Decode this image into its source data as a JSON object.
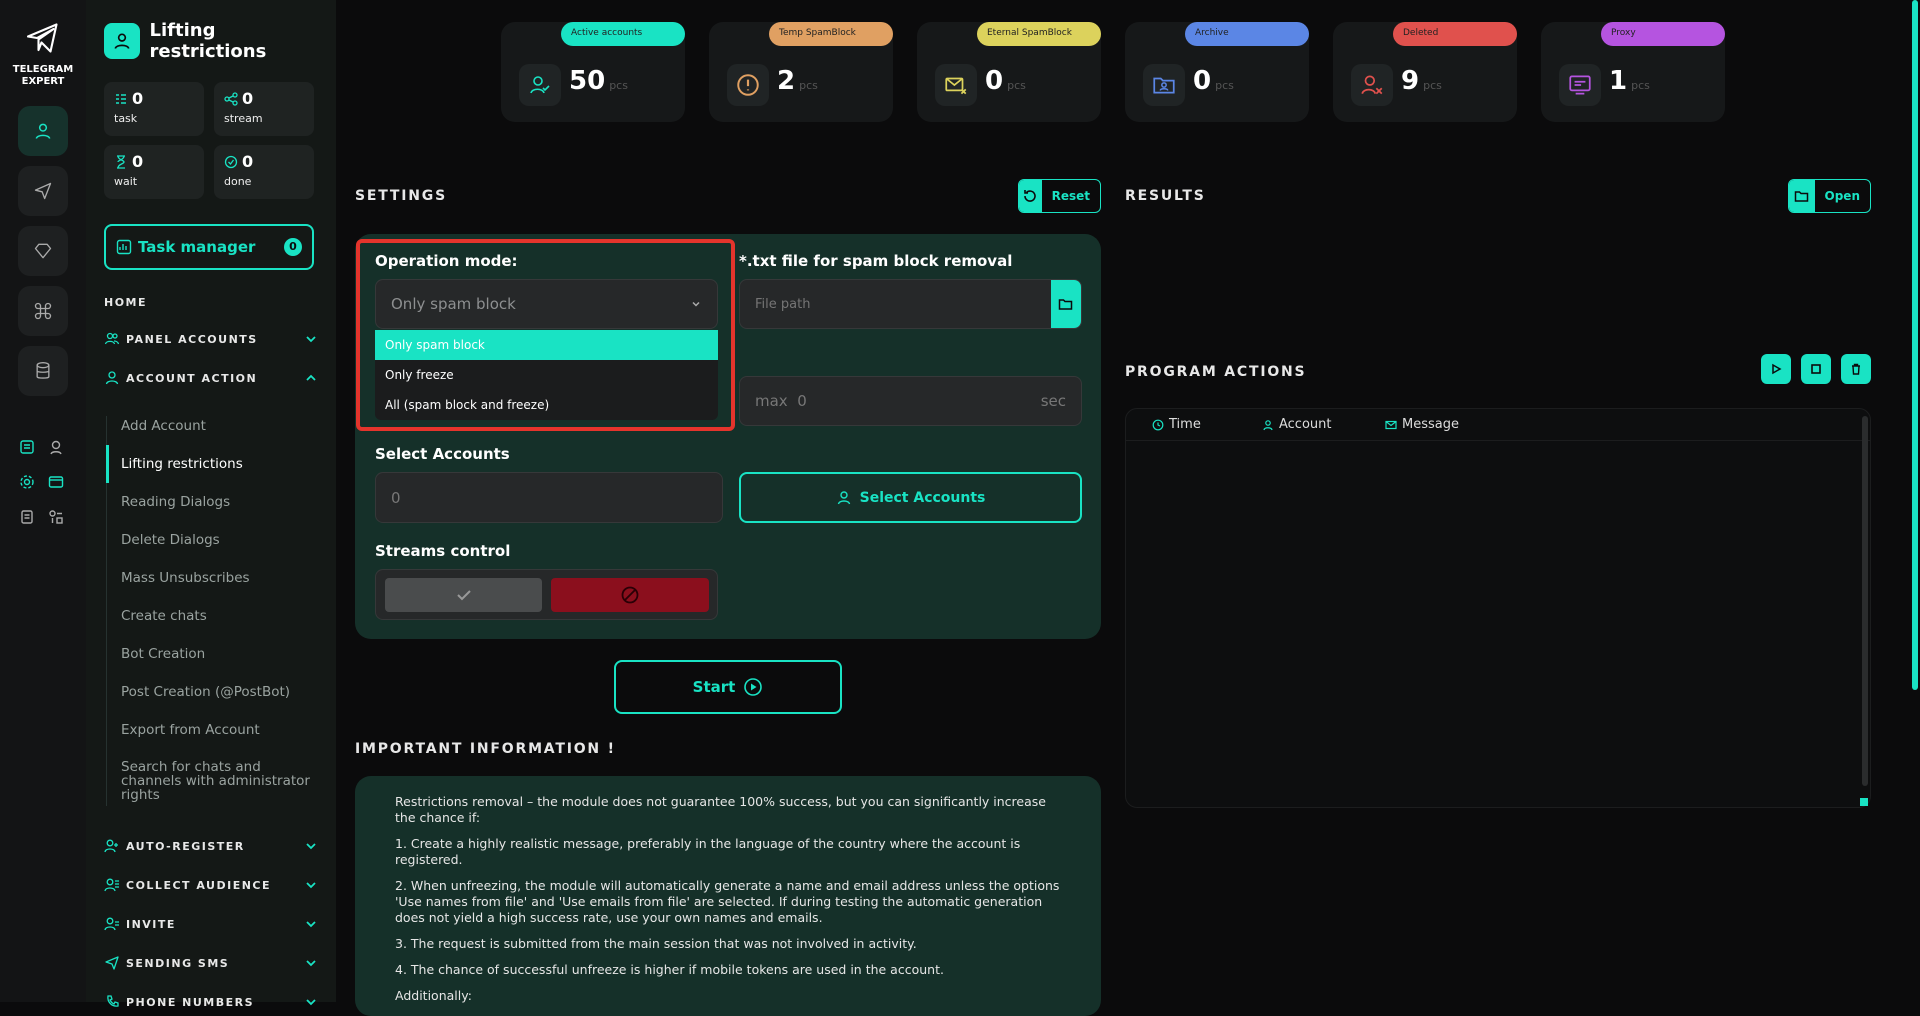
{
  "brand": {
    "line1": "TELEGRAM",
    "line2": "EXPERT"
  },
  "sidebar": {
    "title": "Lifting restrictions",
    "stats": [
      {
        "value": "0",
        "label": "task"
      },
      {
        "value": "0",
        "label": "stream"
      },
      {
        "value": "0",
        "label": "wait"
      },
      {
        "value": "0",
        "label": "done"
      }
    ],
    "task_manager": {
      "label": "Task manager",
      "count": "0"
    },
    "home": "HOME",
    "sections": [
      {
        "label": "PANEL ACCOUNTS"
      },
      {
        "label": "ACCOUNT ACTION"
      },
      {
        "label": "AUTO-REGISTER"
      },
      {
        "label": "COLLECT AUDIENCE"
      },
      {
        "label": "INVITE"
      },
      {
        "label": "SENDING SMS"
      },
      {
        "label": "PHONE NUMBERS"
      }
    ],
    "items": [
      "Add Account",
      "Lifting restrictions",
      "Reading Dialogs",
      "Delete Dialogs",
      "Mass Unsubscribes",
      "Create chats",
      "Bot Creation",
      "Post Creation (@PostBot)",
      "Export from Account",
      "Search for chats and channels with administrator rights"
    ]
  },
  "cards": [
    {
      "tag": "Active accounts",
      "value": "50",
      "unit": "pcs",
      "color": "#19e3c4"
    },
    {
      "tag": "Temp SpamBlock",
      "value": "2",
      "unit": "pcs",
      "color": "#e0a062"
    },
    {
      "tag": "Eternal SpamBlock",
      "value": "0",
      "unit": "pcs",
      "color": "#dcd25c"
    },
    {
      "tag": "Archive",
      "value": "0",
      "unit": "pcs",
      "color": "#5b86e5"
    },
    {
      "tag": "Deleted",
      "value": "9",
      "unit": "pcs",
      "color": "#e0514d"
    },
    {
      "tag": "Proxy",
      "value": "1",
      "unit": "pcs",
      "color": "#b554e0"
    }
  ],
  "settings": {
    "title": "SETTINGS",
    "reset": "Reset",
    "operation_mode": {
      "label": "Operation mode:",
      "value": "Only spam block",
      "options": [
        "Only spam block",
        "Only freeze",
        "All (spam block and freeze)"
      ]
    },
    "spam_file": {
      "label": "*.txt file for spam block removal",
      "placeholder": "File path"
    },
    "delay_max": {
      "prefix": "max",
      "value": "0",
      "unit": "sec"
    },
    "select_accounts": {
      "label": "Select Accounts",
      "value": "0",
      "button": "Select Accounts"
    },
    "streams": {
      "label": "Streams control"
    },
    "start": "Start"
  },
  "important": {
    "title": "IMPORTANT INFORMATION !",
    "paragraphs": [
      "Restrictions removal – the module does not guarantee 100% success, but you can significantly increase the chance if:",
      "1. Create a highly realistic message, preferably in the language of the country where the account is registered.",
      "2. When unfreezing, the module will automatically generate a name and email address unless the options 'Use names from file' and 'Use emails from file' are selected. If during testing the automatic generation does not yield a high success rate, use your own names and emails.",
      "3. The request is submitted from the main session that was not involved in activity.",
      "4. The chance of successful unfreeze is higher if mobile tokens are used in the account.",
      "Additionally:"
    ]
  },
  "results": {
    "title": "RESULTS",
    "open": "Open"
  },
  "program_actions": {
    "title": "PROGRAM ACTIONS",
    "columns": [
      "Time",
      "Account",
      "Message"
    ]
  }
}
